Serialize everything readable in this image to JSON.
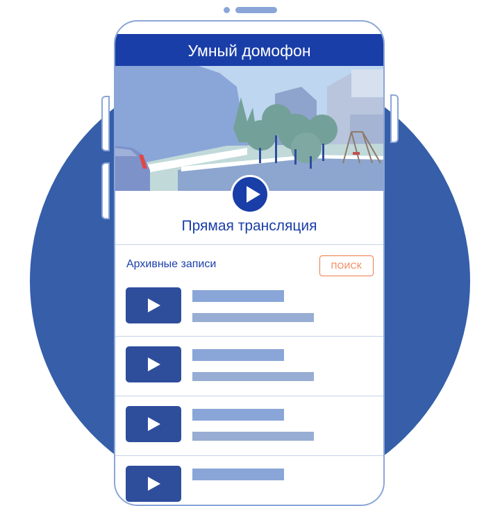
{
  "app": {
    "title": "Умный домофон"
  },
  "live": {
    "title": "Прямая трансляция",
    "play_icon": "play-icon"
  },
  "archive": {
    "label": "Архивные записи",
    "search_label": "ПОИСК",
    "items": [
      {
        "icon": "play-icon"
      },
      {
        "icon": "play-icon"
      },
      {
        "icon": "play-icon"
      },
      {
        "icon": "play-icon"
      }
    ]
  },
  "colors": {
    "brand": "#1a3ea8",
    "circle_bg": "#365ea9",
    "accent": "#f07a4a",
    "placeholder": "#8aa6d8"
  }
}
